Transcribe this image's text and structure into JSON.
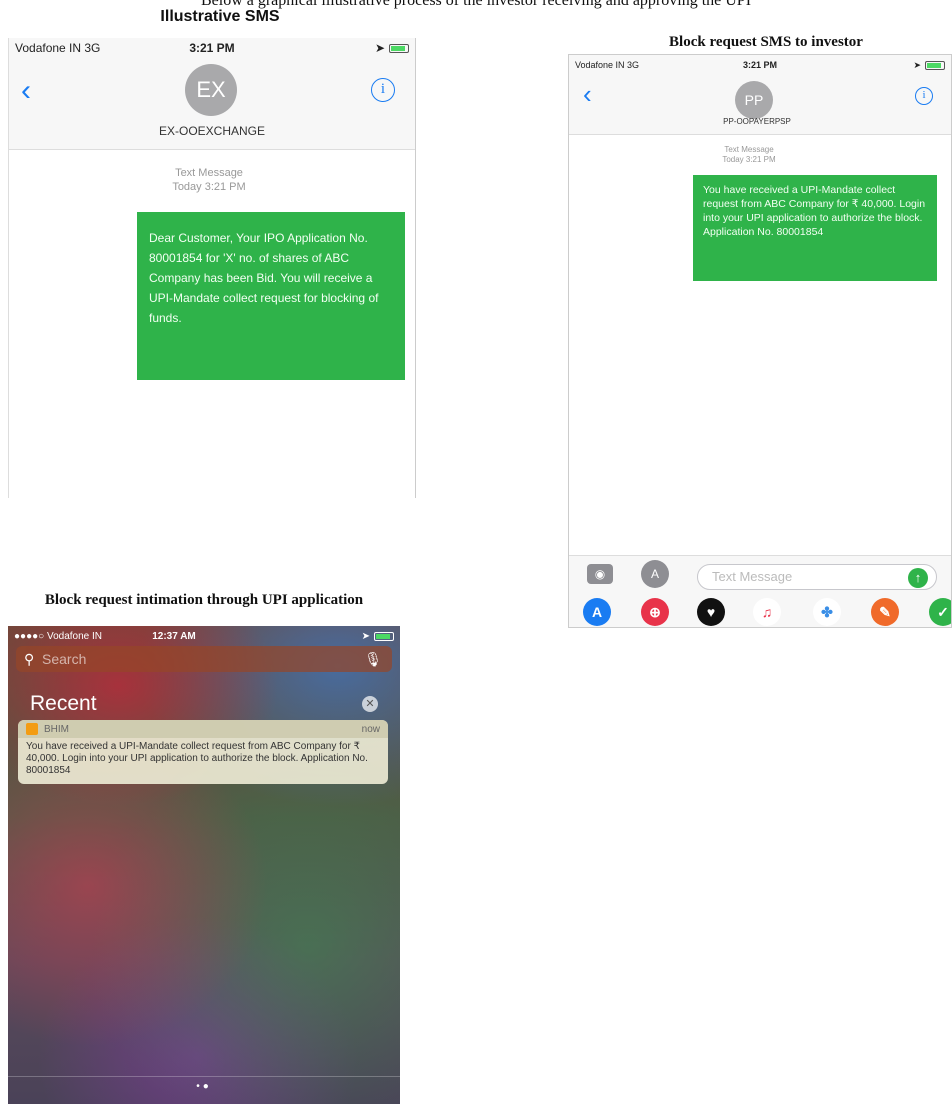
{
  "intro_line": "Below a graphical illustrative process of the investor receiving and approving the UPI",
  "captions": {
    "sms": "Illustrative SMS",
    "block_request": "Block request SMS to investor",
    "upi_app": "Block request intimation through UPI application"
  },
  "phone1": {
    "status": {
      "carrier": "Vodafone IN  3G",
      "time": "3:21 PM"
    },
    "avatar": "EX",
    "contact": "EX-OOEXCHANGE",
    "meta_line1": "Text Message",
    "meta_line2": "Today 3:21 PM",
    "message": "Dear Customer, Your IPO Application No. 80001854 for 'X' no. of shares of ABC Company has been Bid. You will receive a UPI-Mandate collect request for blocking of funds."
  },
  "phone2": {
    "status": {
      "carrier": "Vodafone IN  3G",
      "time": "3:21 PM"
    },
    "avatar": "PP",
    "contact": "PP-OOPAYERPSP",
    "meta_line1": "Text Message",
    "meta_line2": "Today 3:21 PM",
    "message": "You have received a UPI-Mandate collect request from ABC Company for ₹ 40,000. Login into your UPI application to authorize the block. Application No. 80001854",
    "compose_placeholder": "Text Message"
  },
  "phone3": {
    "status": {
      "carrier": "●●●●○ Vodafone IN",
      "time": "12:37 AM"
    },
    "search_placeholder": "Search",
    "recent_title": "Recent",
    "notification": {
      "app": "BHIM",
      "when": "now",
      "body": "You have received a UPI-Mandate collect request from ABC Company for ₹ 40,000. Login into your UPI application to authorize the block. Application No. 80001854"
    }
  },
  "colors": {
    "bubble": "#2fb34a",
    "ios_blue": "#1a7cf2"
  }
}
